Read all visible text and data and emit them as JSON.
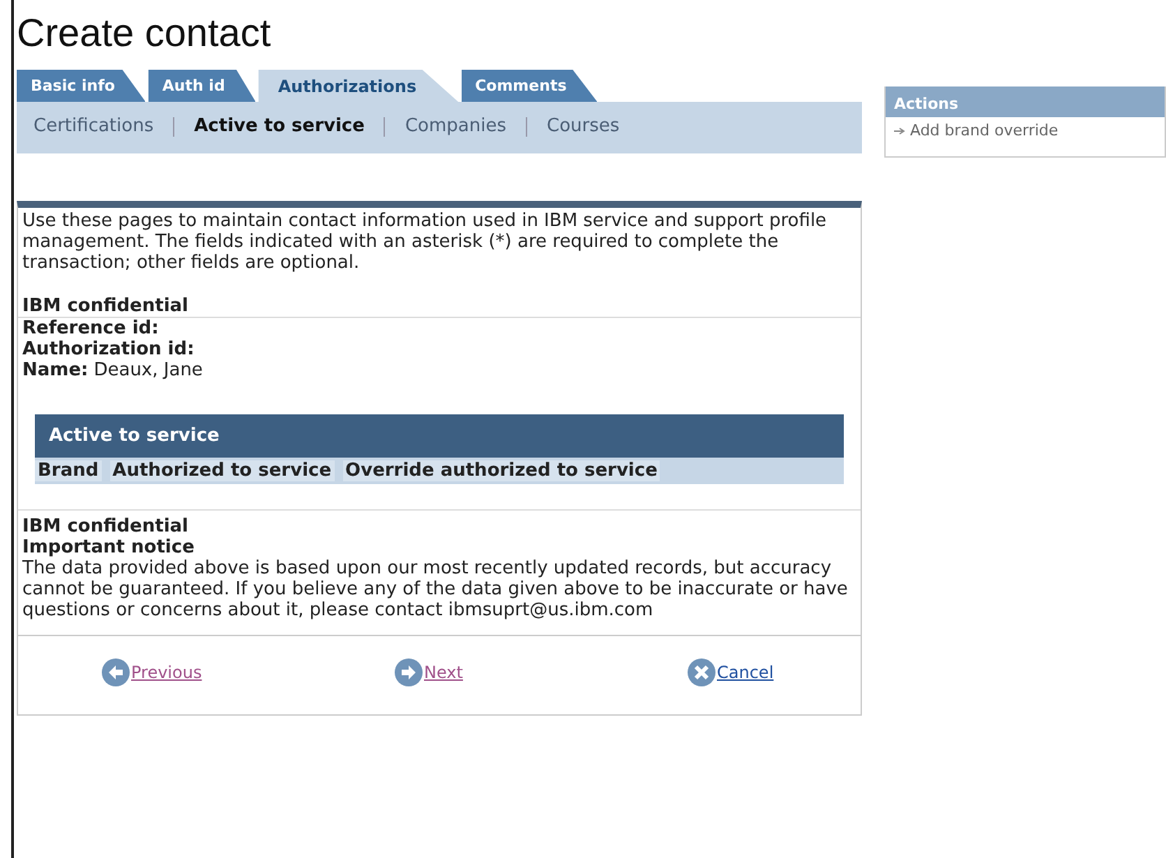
{
  "title": "Create contact",
  "tabs": [
    {
      "label": "Basic info",
      "selected": false
    },
    {
      "label": "Auth id",
      "selected": false
    },
    {
      "label": "Authorizations",
      "selected": true
    },
    {
      "label": "Comments",
      "selected": false
    }
  ],
  "subtabs": [
    {
      "label": "Certifications",
      "selected": false
    },
    {
      "label": "Active to service",
      "selected": true
    },
    {
      "label": "Companies",
      "selected": false
    },
    {
      "label": "Courses",
      "selected": false
    }
  ],
  "intro": "Use these pages to maintain contact information used in IBM service and support profile management. The fields indicated with an asterisk (*) are required to complete the transaction; other fields are optional.",
  "confidential_heading": "IBM confidential",
  "fields": [
    {
      "label": "Reference id:"
    },
    {
      "label": "Authorization id:"
    },
    {
      "label": "Name:",
      "value": "Deaux, Jane"
    }
  ],
  "table": {
    "title": "Active to service",
    "columns": [
      "Brand",
      "Authorized to service",
      "Override authorized to service"
    ]
  },
  "notice": {
    "confidential": "IBM confidential",
    "heading": "Important notice",
    "text": "The data provided above is based upon our most recently updated records, but accuracy cannot be guaranteed. If you believe any of the data given above to be inaccurate or have questions or concerns about it, please contact ibmsuprt@us.ibm.com"
  },
  "buttons": [
    {
      "kind": "previous",
      "label": "Previous",
      "visited": true
    },
    {
      "kind": "next",
      "label": "Next",
      "visited": true
    },
    {
      "kind": "cancel",
      "label": "Cancel",
      "visited": false
    }
  ],
  "actions": {
    "title": "Actions",
    "items": [
      "Add brand override"
    ]
  }
}
